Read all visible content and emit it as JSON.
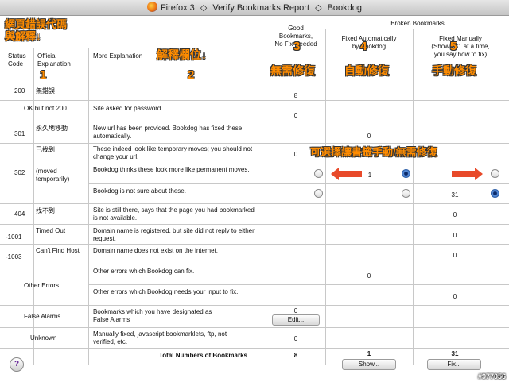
{
  "window": {
    "title_parts": [
      "Firefox 3",
      "Verify Bookmarks Report",
      "Bookdog"
    ],
    "title_sep": "◇"
  },
  "headers": {
    "status_code": "Status\nCode",
    "official": "Official\nExplanation",
    "more": "More Explanation",
    "good": "Good\nBookmarks,\nNo Fix Needed",
    "broken_group": "Broken Bookmarks",
    "fixed_auto": "Fixed Automatically\nby Bookdog",
    "fixed_manual": "Fixed Manually\n(Shown 31 at a time,\nyou say how to fix)"
  },
  "rows": {
    "r200": {
      "code": "200",
      "official": "無錯誤",
      "good": "8"
    },
    "r200ok": {
      "code": "OK but not 200",
      "more": "Site asked for password.",
      "good": "0"
    },
    "r301": {
      "code": "301",
      "official": "永久地移動",
      "more": "New url has been provided.  Bookdog has fixed these automatically.",
      "auto": "0"
    },
    "r302": {
      "code": "302",
      "official1": "已找到",
      "official2": "(moved\ntemporarily)",
      "more_a": "These indeed look like temporary moves; you should not change your url.",
      "good_a": "0",
      "more_b": "Bookdog thinks these look more like permanent moves.",
      "auto_b": "1",
      "more_c": "Bookdog is not sure about these.",
      "manual_c": "31"
    },
    "r404": {
      "code": "404",
      "official": "找不到",
      "more": "Site is still there, says that the page you had bookmarked is not available.",
      "manual": "0"
    },
    "r1001": {
      "code": "-1001",
      "official": "Timed Out",
      "more": "Domain name is registered, but site did not reply to either request.",
      "manual": "0"
    },
    "r1003": {
      "code": "-1003",
      "official": "Can't Find Host",
      "more": "Domain name does not exist on the internet.",
      "manual": "0"
    },
    "rOther": {
      "code": "Other Errors",
      "more_a": "Other errors which Bookdog can fix.",
      "auto_a": "0",
      "more_b": "Other errors which Bookdog needs your input to fix.",
      "manual_b": "0"
    },
    "rFalse": {
      "code": "False Alarms",
      "more": "Bookmarks which you have designated as False Alarms",
      "good": "0",
      "edit": "Edit..."
    },
    "rUnknown": {
      "code": "Unknown",
      "more": "Manually fixed, javascript bookmarklets, ftp, not verified, etc.",
      "good": "0"
    },
    "rTotal": {
      "label": "Total Numbers of Bookmarks",
      "good": "8",
      "auto": "1",
      "manual": "31",
      "show": "Show...",
      "fix": "Fix..."
    }
  },
  "annotations": {
    "a1_title": "網頁錯誤代碼\n與解釋↓",
    "a1_num": "1",
    "a2_title": "解釋欄位↓",
    "a2_num": "2",
    "a3_num": "3",
    "a3_text": "無需修復",
    "a4_num": "4",
    "a4_text": "自動修復",
    "a5_num": "5",
    "a5_text": "手動修復",
    "choice": "可選擇讓書籤手動/無需修復"
  },
  "help_label": "?",
  "watermark": "#977056",
  "colors": {
    "annotation": "#ff8c00",
    "arrow": "#e84a2a",
    "radio_on": "#2e6ac4"
  }
}
